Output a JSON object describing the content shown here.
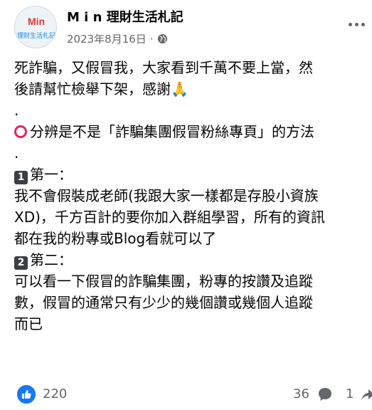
{
  "post": {
    "author": "M i n 理財生活札記",
    "date": "2023年8月16日",
    "separator": "·",
    "avatar_text_top": "Min",
    "avatar_text_bottom": "理財生活札記",
    "lines": [
      "死詐騙，又假冒我，大家看到千萬不要上當，然",
      "後請幫忙檢舉下架，感謝",
      ".",
      "分辨是不是「詐騙集團假冒粉絲專頁」的方法",
      ".",
      "第一：",
      "我不會假裝成老師(我跟大家一樣都是存股小資族",
      "XD)，千方百計的要你加入群組學習，所有的資訊",
      "都在我的粉專或Blog看就可以了",
      "第二：",
      "可以看一下假冒的詐騙集團，粉專的按讚及追蹤",
      "數，假冒的通常只有少少的幾個讚或幾個人追蹤",
      "而已"
    ],
    "pray_emoji": "🙏",
    "keycap_1": "1",
    "keycap_2": "2"
  },
  "footer": {
    "likes": "220",
    "comments": "36",
    "shares": "1"
  },
  "icons": {
    "more": "more-options-icon",
    "globe": "globe-icon",
    "like": "like-icon",
    "comment": "comment-icon",
    "share": "share-icon",
    "ring": "red-circle-icon"
  },
  "colors": {
    "like_blue": "#1877f2",
    "meta_gray": "#65676b",
    "ring_red": "#e0245e"
  }
}
